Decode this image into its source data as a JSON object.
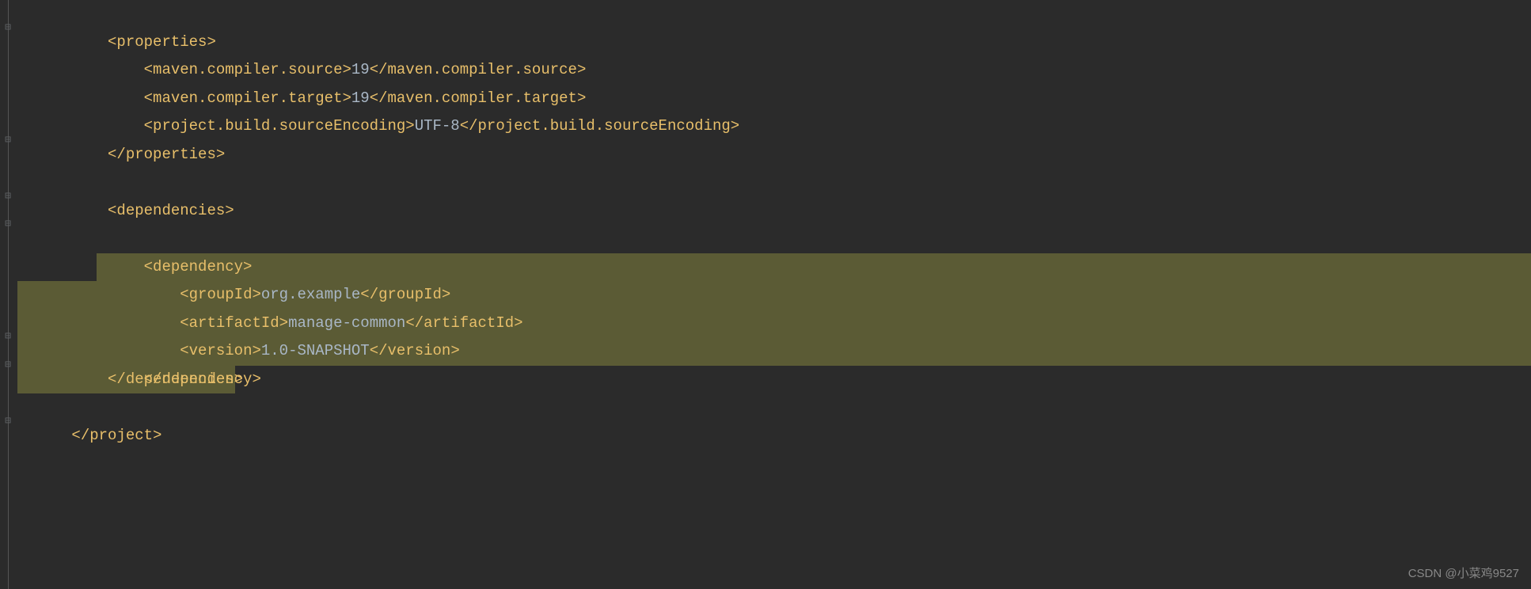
{
  "code": {
    "line1": {
      "indent": "    ",
      "tag_open": "<properties>"
    },
    "line2": {
      "indent": "        ",
      "tag_open": "<maven.compiler.source>",
      "value": "19",
      "tag_close": "</maven.compiler.source>"
    },
    "line3": {
      "indent": "        ",
      "tag_open": "<maven.compiler.target>",
      "value": "19",
      "tag_close": "</maven.compiler.target>"
    },
    "line4": {
      "indent": "        ",
      "tag_open": "<project.build.sourceEncoding>",
      "value": "UTF-8",
      "tag_close": "</project.build.sourceEncoding>"
    },
    "line5": {
      "indent": "    ",
      "tag_close": "</properties>"
    },
    "line7": {
      "indent": "    ",
      "tag_open": "<dependencies>"
    },
    "line8": {
      "indent": "        ",
      "tag_open": "<dependency>"
    },
    "line9": {
      "indent": "            ",
      "tag_open": "<groupId>",
      "value": "org.example",
      "tag_close": "</groupId>"
    },
    "line10": {
      "indent": "            ",
      "tag_open": "<artifactId>",
      "value": "manage-common",
      "tag_close": "</artifactId>"
    },
    "line11": {
      "indent": "            ",
      "tag_open": "<version>",
      "value": "1.0-SNAPSHOT",
      "tag_close": "</version>"
    },
    "line12": {
      "indent": "        ",
      "tag_close": "</dependency>"
    },
    "line13": {
      "indent": "    ",
      "tag_close": "</dependencies>"
    },
    "line15": {
      "tag_close": "</project>"
    }
  },
  "watermark": "CSDN @小菜鸡9527"
}
